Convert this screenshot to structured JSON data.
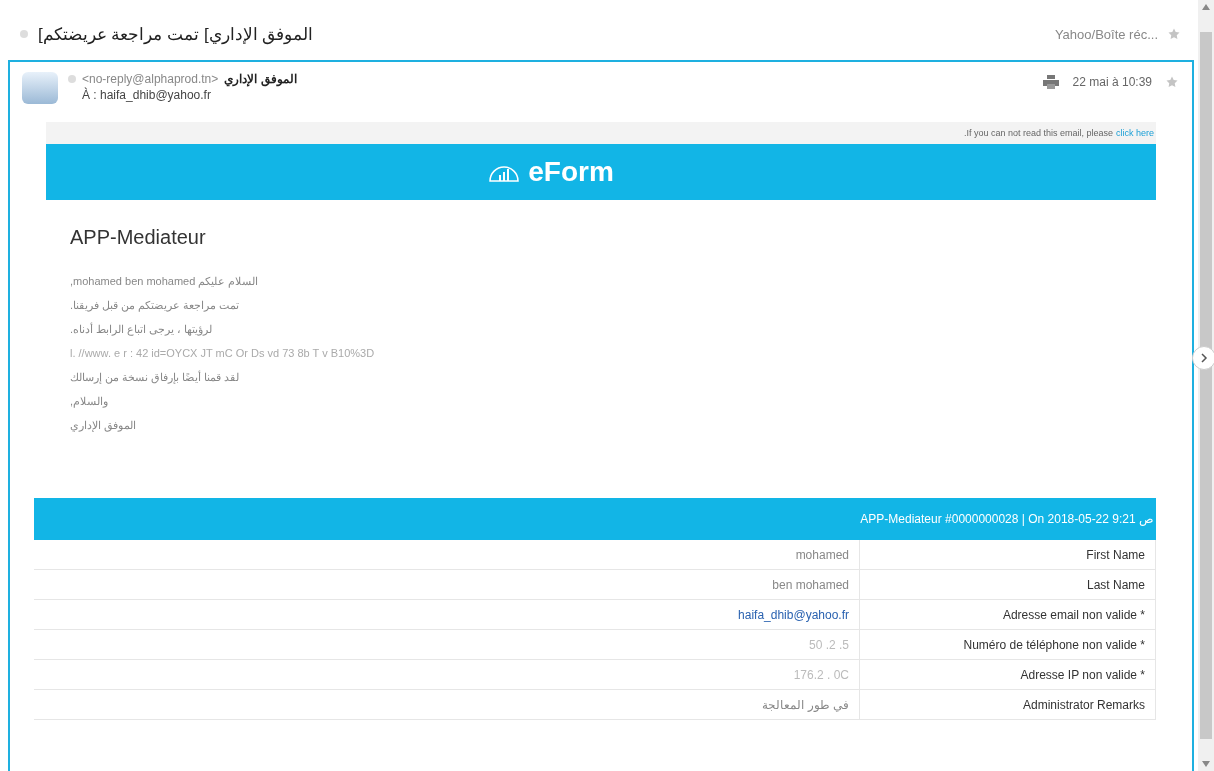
{
  "thread": {
    "subject": "الموفق الإداري] تمت مراجعة عريضتكم]",
    "folder": "Yahoo/Boîte réc...",
    "starred": false
  },
  "message": {
    "sender_name": "الموفق الإداري",
    "sender_email": "<no-reply@alphaprod.tn>",
    "to": "À : haifa_dhib@yahoo.fr",
    "date": "22 mai à 10:39",
    "starred": false
  },
  "email": {
    "notice": ".If you can not read this email, please",
    "notice_link": "click here",
    "brand": "eForm",
    "heading": "APP-Mediateur",
    "lines": [
      {
        "kind": "text",
        "text": "السلام عليكم mohamed ben mohamed,"
      },
      {
        "kind": "text",
        "text": "تمت مراجعة عريضتكم من قبل فريقنا."
      },
      {
        "kind": "text",
        "text": "لرؤيتها ، يرجى اتباع الرابط أدناه."
      },
      {
        "kind": "blurred",
        "text": "l. //www.  e r  :  42  id=OYCX  JT  mC  Or  Ds  vd  73  8b  T  v B10%3D"
      },
      {
        "kind": "text",
        "text": "لقد قمنا أيضًا بإرفاق نسخة من إرسالك"
      },
      {
        "kind": "text",
        "text": "والسلام,"
      },
      {
        "kind": "text",
        "text": "الموفق الإداري"
      }
    ],
    "table": {
      "title": "APP-Mediateur #0000000028 | On 2018-05-22 9:21 ص",
      "rows": [
        {
          "label": "First Name",
          "value": "mohamed",
          "kind": "text"
        },
        {
          "label": "Last Name",
          "value": "ben mohamed",
          "kind": "text"
        },
        {
          "label": "Adresse email non valide *",
          "value": "haifa_dhib@yahoo.fr",
          "kind": "link"
        },
        {
          "label": "Numéro de téléphone non valide *",
          "value": "50 .2 .5",
          "kind": "blurred"
        },
        {
          "label": "Adresse IP non valide *",
          "value": "176.2 .  0C",
          "kind": "blurred"
        },
        {
          "label": "Administrator Remarks",
          "value": "في طور المعالجة",
          "kind": "text"
        }
      ]
    }
  }
}
